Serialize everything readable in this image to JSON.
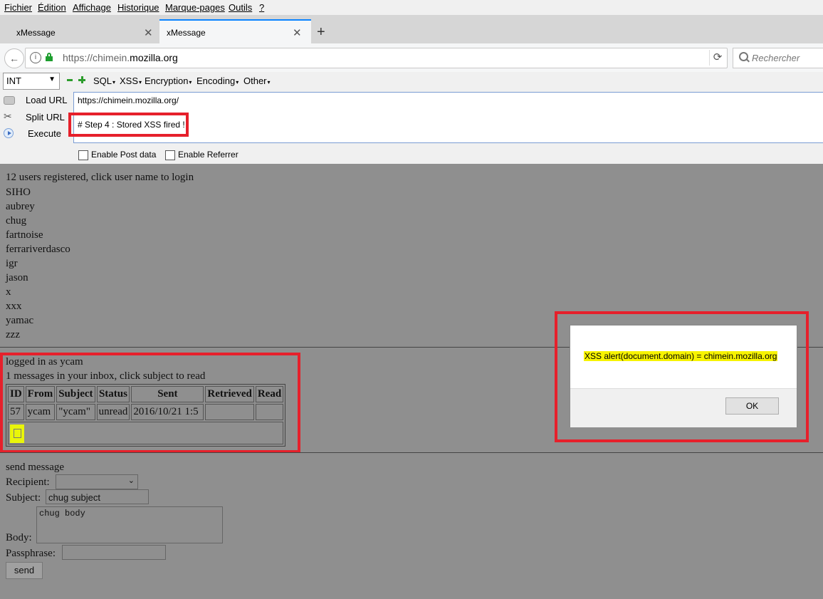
{
  "menubar": [
    "Fichier",
    "Édition",
    "Affichage",
    "Historique",
    "Marque-pages",
    "Outils",
    "?"
  ],
  "tabs": [
    {
      "title": "xMessage"
    },
    {
      "title": "xMessage"
    }
  ],
  "navbar": {
    "url_prefix": "https://chimein.",
    "url_domain": "mozilla.org",
    "search_placeholder": "Rechercher"
  },
  "hackbar": {
    "select_value": "INT",
    "menus": [
      "SQL",
      "XSS",
      "Encryption",
      "Encoding",
      "Other"
    ],
    "load_url": "Load URL",
    "split_url": "Split URL",
    "execute": "Execute",
    "url_line": "https://chimein.mozilla.org/",
    "note_line": "# Step 4 : Stored XSS fired !",
    "enable_post": "Enable Post data",
    "enable_referrer": "Enable Referrer"
  },
  "page": {
    "user_count": "12 users registered, click user name to login",
    "users": [
      "SIHO",
      "aubrey",
      "chug",
      "fartnoise",
      "ferrariverdasco",
      "igr",
      "jason",
      "x",
      "xxx",
      "yamac",
      "zzz"
    ],
    "logged_in": "logged in as ycam",
    "inbox_count": "1 messages in your inbox, click subject to read",
    "table_headers": [
      "ID",
      "From",
      "Subject",
      "Status",
      "Sent",
      "Retrieved",
      "Read"
    ],
    "table_rows": [
      [
        "57",
        "ycam",
        "\"ycam\"",
        "unread",
        "2016/10/21 1:5",
        "",
        ""
      ]
    ],
    "send_title": "send message",
    "recipient_label": "Recipient:",
    "subject_label": "Subject:",
    "subject_value": "chug subject",
    "body_label": "Body:",
    "body_value": "chug body",
    "passphrase_label": "Passphrase:",
    "send_button": "send"
  },
  "alert": {
    "message": "XSS alert(document.domain) = chimein.mozilla.org",
    "ok": "OK"
  },
  "colors": {
    "highlight_red": "#e6202b",
    "alert_yellow": "#f7f300",
    "page_bg": "#8f8f8f"
  }
}
